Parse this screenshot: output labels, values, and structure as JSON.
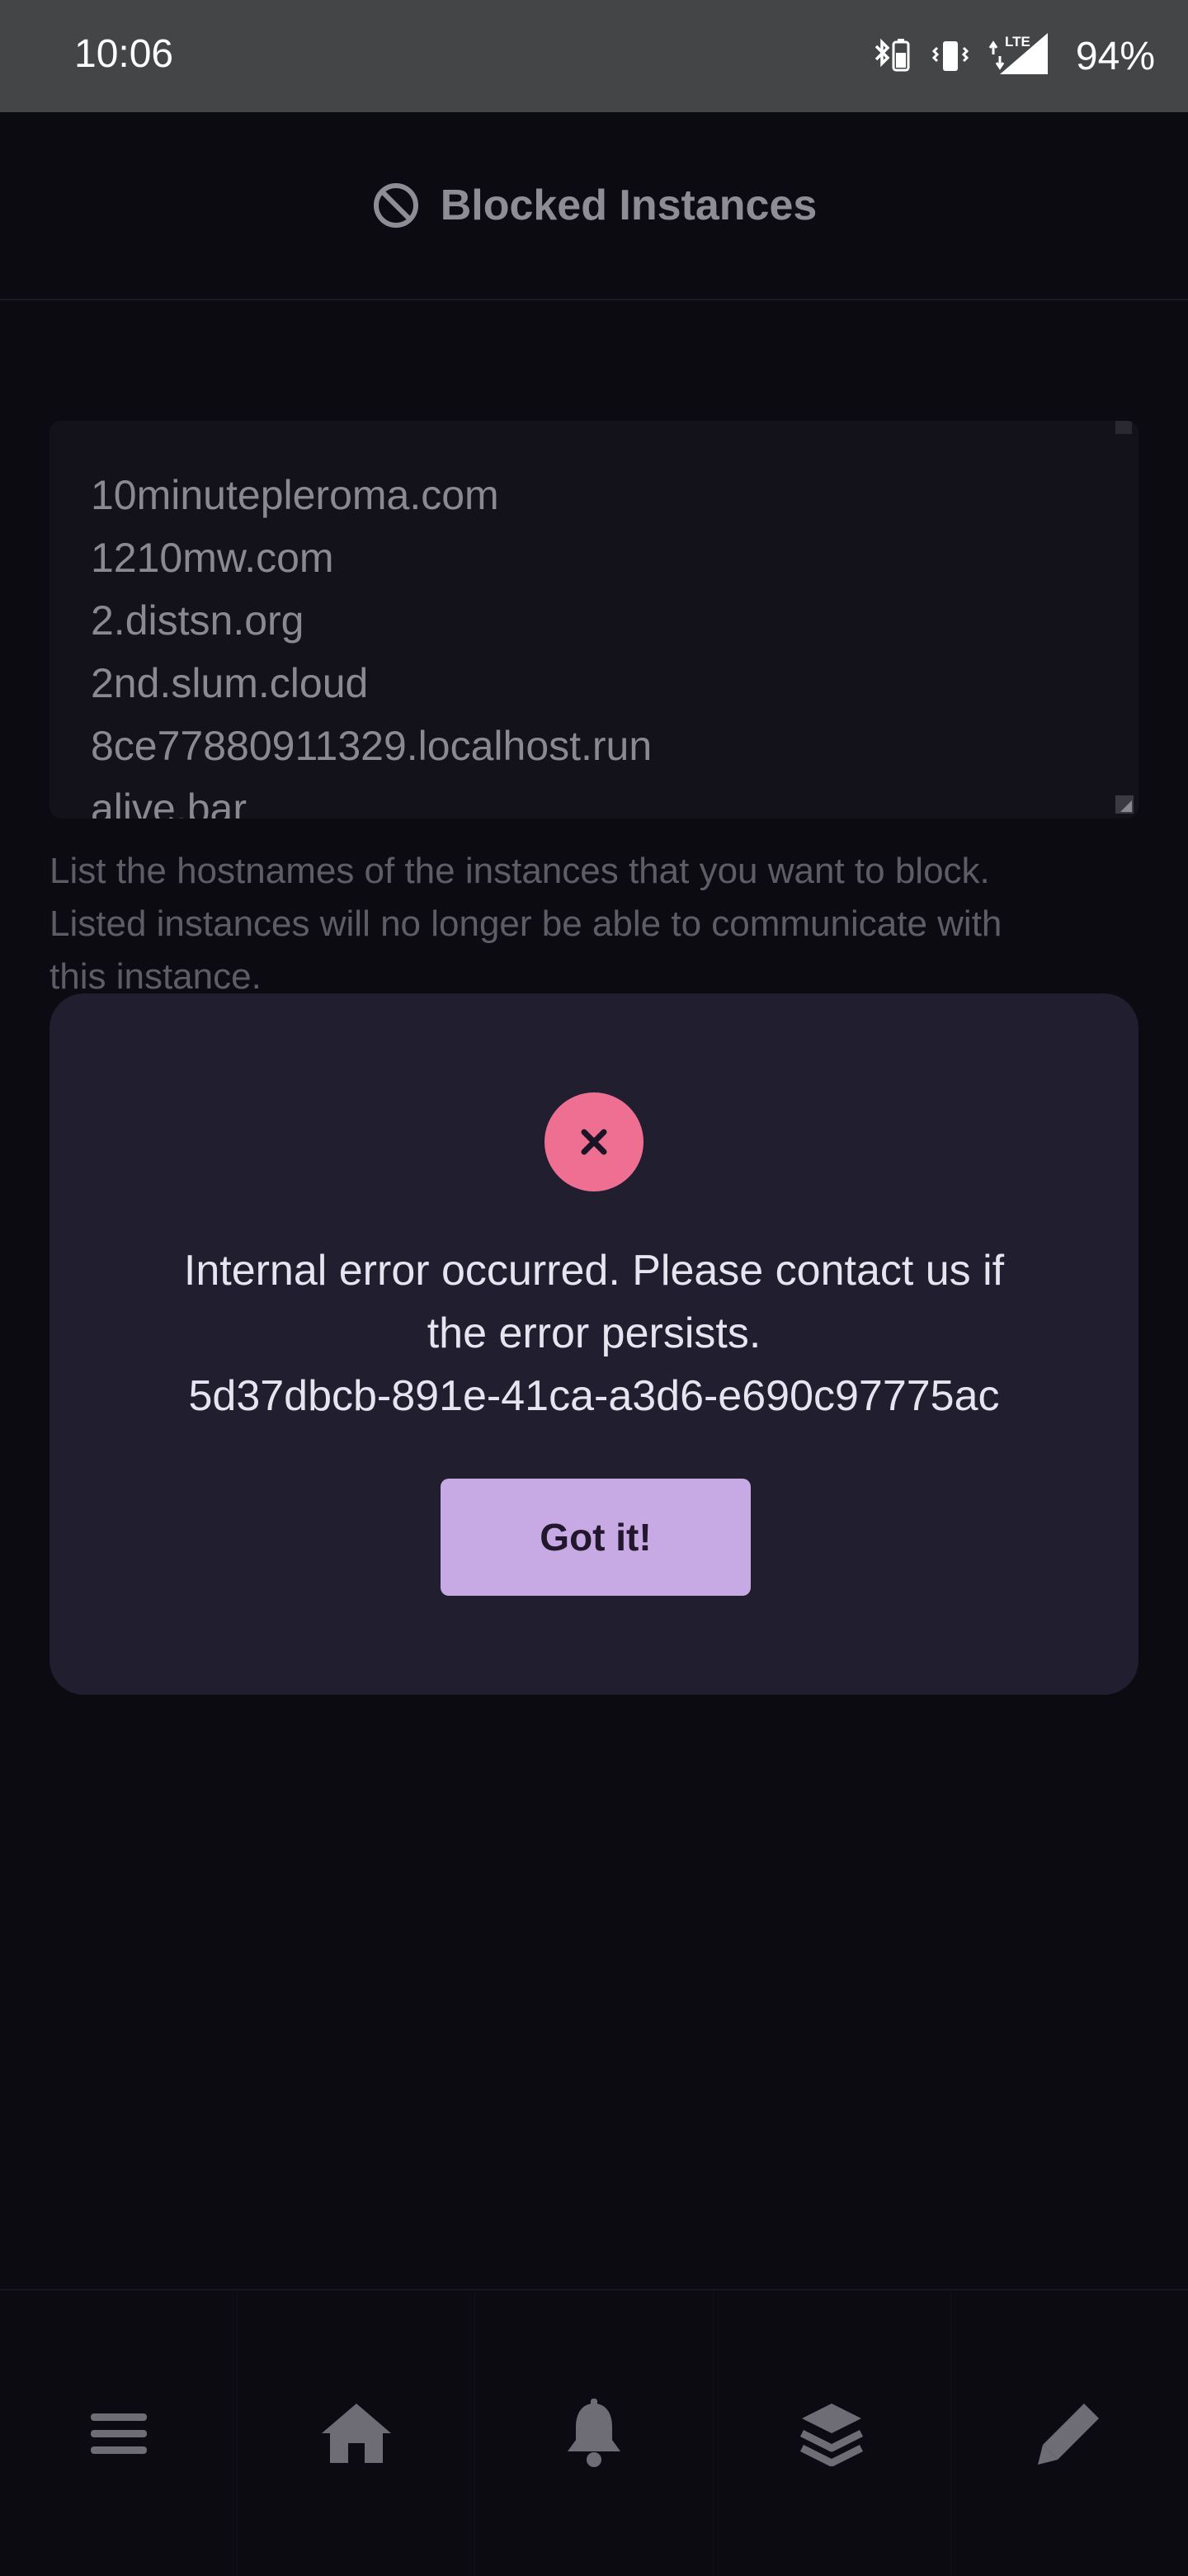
{
  "status_bar": {
    "time": "10:06",
    "network": "LTE",
    "battery": "94%",
    "icons": [
      "bluetooth-battery-icon",
      "vibrate-icon",
      "lte-signal-icon"
    ]
  },
  "header": {
    "icon": "block-icon",
    "title": "Blocked Instances"
  },
  "blocked_instances": {
    "lines": [
      "10minutepleroma.com",
      "1210mw.com",
      "2.distsn.org",
      "2nd.slum.cloud",
      "8ce77880911329.localhost.run",
      "alive.bar"
    ],
    "help_lines": [
      "List the hostnames of the instances that you want to block.",
      "Listed instances will no longer be able to communicate with",
      "this instance."
    ]
  },
  "error_dialog": {
    "icon": "close-icon",
    "message_lines": [
      "Internal error occurred. Please contact us if",
      "the error persists.",
      "5d37dbcb-891e-41ca-a3d6-e690c97775ac"
    ],
    "button_label": "Got it!"
  },
  "bottom_nav": {
    "items": [
      "menu-icon",
      "home-icon",
      "bell-icon",
      "layers-icon",
      "pencil-icon"
    ]
  },
  "colors": {
    "background": "#0c0b12",
    "modal": "#201e2f",
    "error_accent": "#ef6f92",
    "button": "#c7a9e3"
  }
}
